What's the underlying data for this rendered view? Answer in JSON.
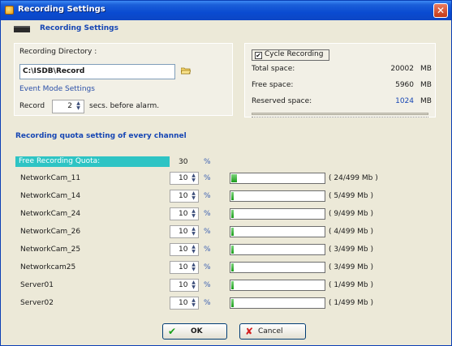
{
  "window": {
    "title": "Recording Settings",
    "close_glyph": "✕"
  },
  "header": {
    "title": "Recording Settings"
  },
  "directory": {
    "label": "Recording Directory :",
    "value": "C:\\ISDB\\Record"
  },
  "event_mode": {
    "label": "Event Mode Settings",
    "record_label": "Record",
    "record_value": "2",
    "record_after": "secs. before alarm."
  },
  "storage": {
    "cycle_checked": true,
    "cycle_label": "Cycle Recording",
    "rows": [
      {
        "label": "Total space:",
        "value": "20002",
        "unit": "MB",
        "highlight": false
      },
      {
        "label": "Free space:",
        "value": "5960",
        "unit": "MB",
        "highlight": false
      },
      {
        "label": "Reserved space:",
        "value": "1024",
        "unit": "MB",
        "highlight": true
      }
    ]
  },
  "quota": {
    "title": "Recording quota setting of every channel",
    "free_label": "Free Recording Quota:",
    "free_value": "30",
    "free_unit": "%",
    "channels": [
      {
        "name": "NetworkCam_11",
        "value": "10",
        "unit": "%",
        "usage": "( 24/499 Mb )",
        "fill": 0.06
      },
      {
        "name": "NetworkCam_14",
        "value": "10",
        "unit": "%",
        "usage": "( 5/499 Mb )",
        "fill": 0.02
      },
      {
        "name": "NetworkCam_24",
        "value": "10",
        "unit": "%",
        "usage": "( 9/499 Mb )",
        "fill": 0.02
      },
      {
        "name": "NetworkCam_26",
        "value": "10",
        "unit": "%",
        "usage": "( 4/499 Mb )",
        "fill": 0.02
      },
      {
        "name": "NetworkCam_25",
        "value": "10",
        "unit": "%",
        "usage": "( 3/499 Mb )",
        "fill": 0.02
      },
      {
        "name": "Networkcam25",
        "value": "10",
        "unit": "%",
        "usage": "( 3/499 Mb )",
        "fill": 0.02
      },
      {
        "name": "Server01",
        "value": "10",
        "unit": "%",
        "usage": "( 1/499 Mb )",
        "fill": 0.02
      },
      {
        "name": "Server02",
        "value": "10",
        "unit": "%",
        "usage": "( 1/499 Mb )",
        "fill": 0.02
      }
    ]
  },
  "buttons": {
    "ok_label": "OK",
    "ok_icon": "✔",
    "cancel_label": "Cancel",
    "cancel_icon": "✘"
  },
  "colors": {
    "accent": "#1646b4",
    "free_quota_bg": "#2ec4c4",
    "bar_fill": "#1c9d1c",
    "highlight_value": "#1646b4"
  }
}
